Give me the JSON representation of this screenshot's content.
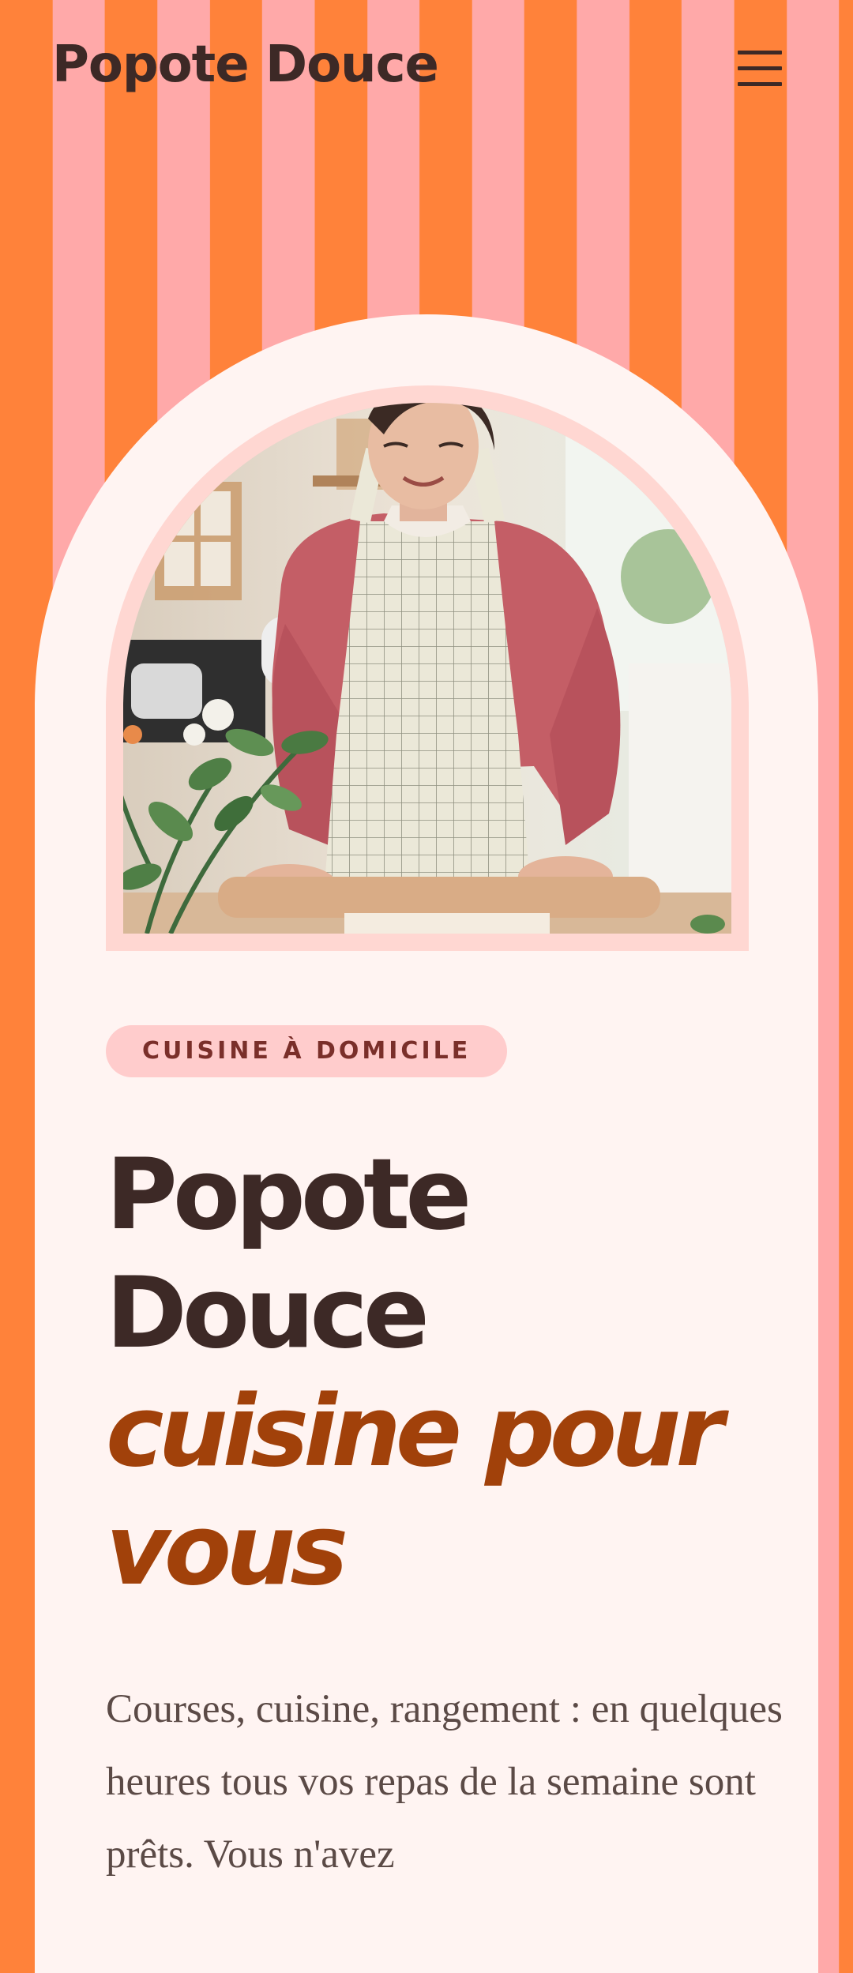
{
  "header": {
    "brand": "Popote Douce",
    "menu_icon": "hamburger-menu-icon"
  },
  "hero": {
    "tag": "CUISINE À DOMICILE",
    "title_line1": "Popote",
    "title_line2": "Douce",
    "title_accent_line1": "cuisine pour",
    "title_accent_line2": "vous",
    "lead": "Courses, cuisine, rangement : en quelques heures tous vos repas de la semaine sont prêts. Vous n'avez"
  },
  "colors": {
    "stripe_orange": "#ff823a",
    "stripe_pink": "#ffa9a9",
    "card_background": "#fff4f2",
    "frame_pink": "#ffd7d2",
    "tag_background": "#ffcccc",
    "text_dark": "#3d2926",
    "accent_rust": "#a1410a"
  }
}
